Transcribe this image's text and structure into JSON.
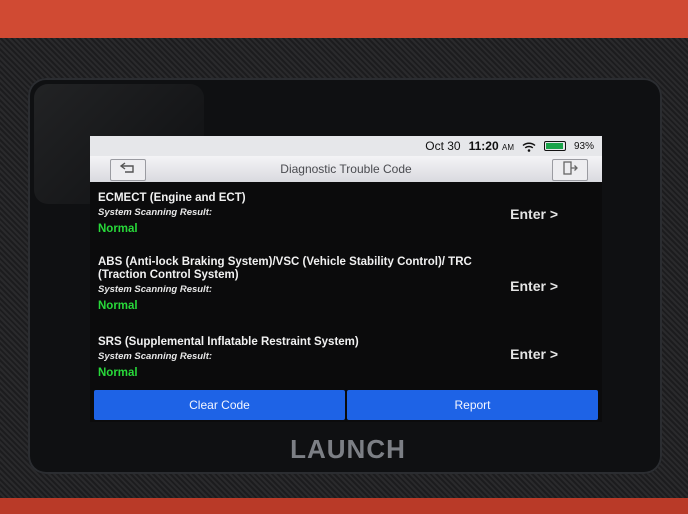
{
  "device": {
    "brand": "LAUNCH"
  },
  "statusbar": {
    "date": "Oct 30",
    "time": "11:20",
    "ampm": "AM",
    "battery": "93%"
  },
  "header": {
    "title": "Diagnostic Trouble Code"
  },
  "systems": [
    {
      "name": "ECMECT (Engine and ECT)",
      "label": "System Scanning Result:",
      "status": "Normal",
      "action": "Enter >"
    },
    {
      "name": "ABS (Anti-lock Braking System)/VSC (Vehicle Stability Control)/ TRC (Traction Control System)",
      "label": "System Scanning Result:",
      "status": "Normal",
      "action": "Enter >"
    },
    {
      "name": "SRS (Supplemental Inflatable Restraint System)",
      "label": "System Scanning Result:",
      "status": "Normal",
      "action": "Enter >"
    }
  ],
  "actions": {
    "clear": "Clear Code",
    "report": "Report"
  },
  "colors": {
    "accent": "#1e63e6",
    "normal": "#28d93a",
    "housing": "#c8432e"
  }
}
